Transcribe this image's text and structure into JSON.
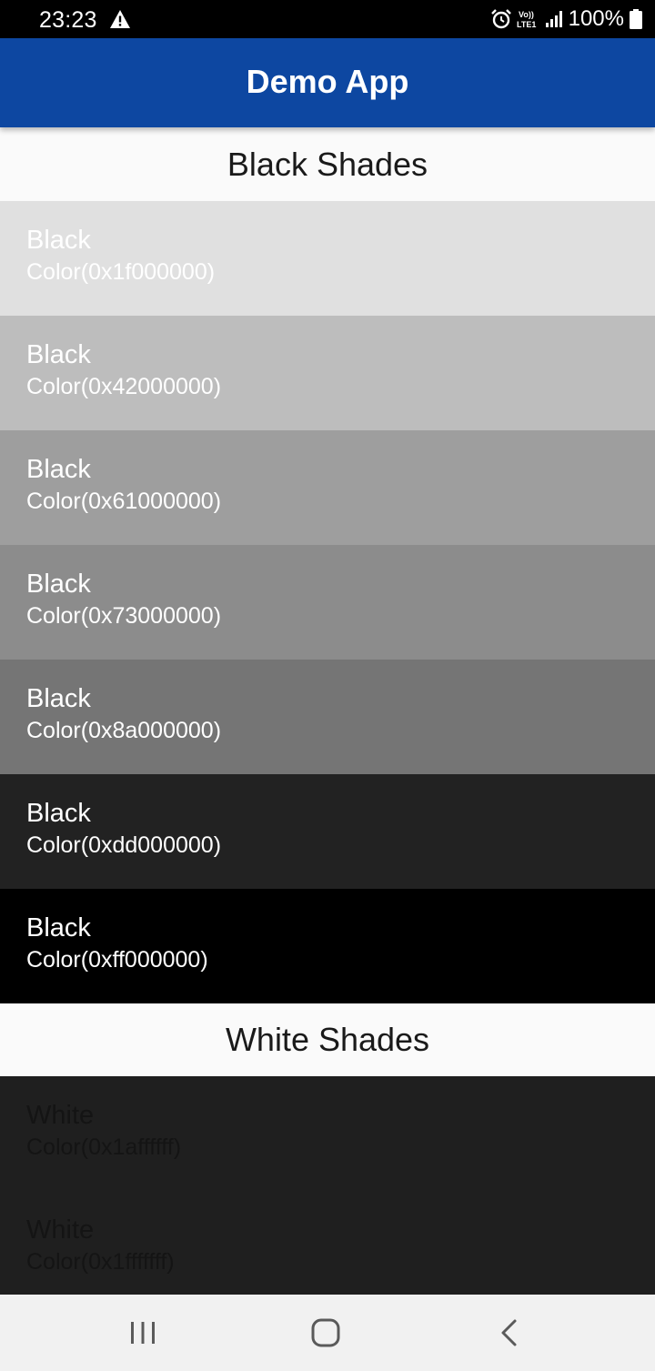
{
  "status_bar": {
    "time": "23:23",
    "volte_label": "Vo)) LTE1",
    "battery_text": "100%",
    "icons": [
      "warning-icon",
      "alarm-icon",
      "volte-icon",
      "signal-icon",
      "battery-icon"
    ]
  },
  "app_bar": {
    "title": "Demo App",
    "color": "#0d47a1"
  },
  "sections": [
    {
      "header": "Black Shades",
      "rows": [
        {
          "name": "Black",
          "code": "Color(0x1f000000)",
          "background": "#e0e0e0"
        },
        {
          "name": "Black",
          "code": "Color(0x42000000)",
          "background": "#bdbdbd"
        },
        {
          "name": "Black",
          "code": "Color(0x61000000)",
          "background": "#9e9e9e"
        },
        {
          "name": "Black",
          "code": "Color(0x73000000)",
          "background": "#8c8c8c"
        },
        {
          "name": "Black",
          "code": "Color(0x8a000000)",
          "background": "#757575"
        },
        {
          "name": "Black",
          "code": "Color(0xdd000000)",
          "background": "#222222"
        },
        {
          "name": "Black",
          "code": "Color(0xff000000)",
          "background": "#000000"
        }
      ]
    },
    {
      "header": "White Shades",
      "rows": [
        {
          "name": "White",
          "code": "Color(0x1affffff)",
          "background": "#1f1f1f"
        },
        {
          "name": "White",
          "code": "Color(0x1fffffff)",
          "background": "#1f1f1f"
        }
      ]
    }
  ],
  "nav_bar": {
    "buttons": [
      "recents-icon",
      "home-icon",
      "back-icon"
    ]
  }
}
